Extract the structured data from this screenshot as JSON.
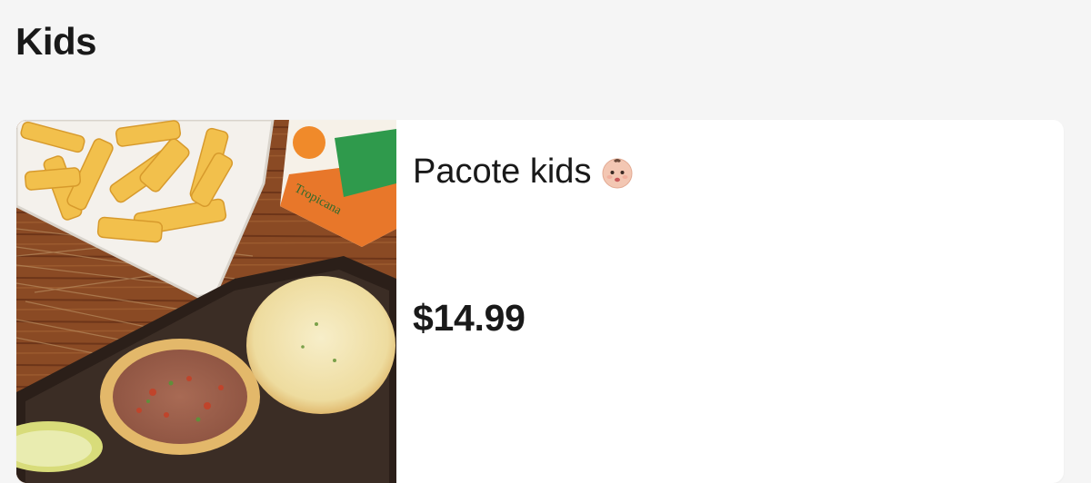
{
  "section": {
    "title": "Kids"
  },
  "menu_item": {
    "name": "Pacote kids",
    "name_emoji": "baby-face-icon",
    "price": "$14.99",
    "image": "kids-meal-photo"
  },
  "colors": {
    "page_bg": "#f5f5f5",
    "card_bg": "#ffffff",
    "text": "#191919"
  }
}
